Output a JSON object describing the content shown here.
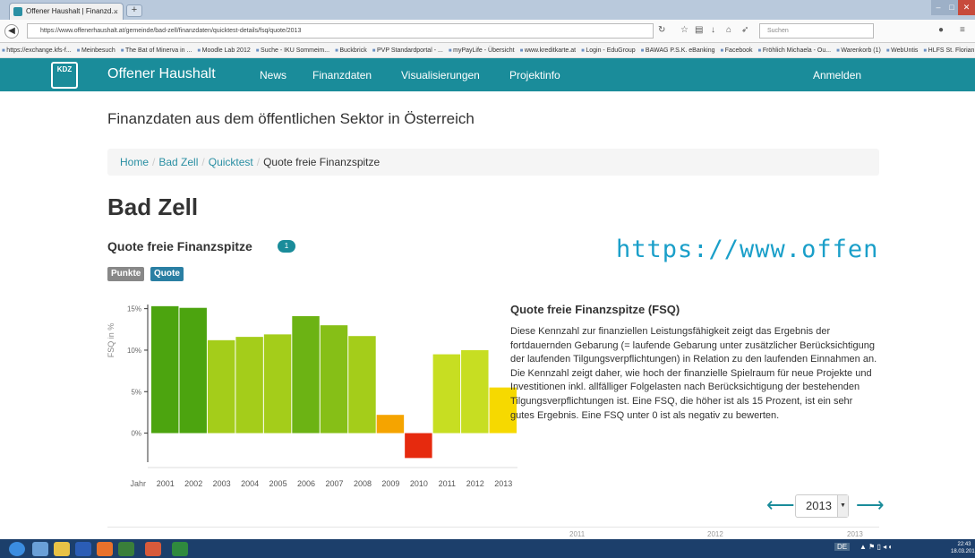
{
  "browser": {
    "tab_title": "Offener Haushalt | Finanzd...",
    "tab_close": "×",
    "new_tab": "+",
    "url": "https://www.offenerhaushalt.at/gemeinde/bad-zell/finanzdaten/quicktest-details/fsq/quote/2013",
    "search_placeholder": "Suchen",
    "bookmarks": [
      "https://exchange.kfs-f...",
      "Meinbesuch",
      "The Bat of Minerva in ...",
      "Moodle Lab 2012",
      "Suche - IKU Sommeim...",
      "Buckbrick",
      "PVP Standardportal - ...",
      "myPayLife - Übersicht",
      "www.kreditkarte.at",
      "Login - EduGroup",
      "BAWAG P.S.K. eBanking",
      "Facebook",
      "Fröhlich Michaela - Ou...",
      "Warenkorb (1)",
      "WebUntis",
      "HLFS St. Florian: Login ..."
    ]
  },
  "header": {
    "logo_text": "KDZ",
    "brand": "Offener Haushalt",
    "nav": [
      "News",
      "Finanzdaten",
      "Visualisierungen",
      "Projektinfo"
    ],
    "login": "Anmelden"
  },
  "page": {
    "subtitle": "Finanzdaten aus dem öffentlichen Sektor in Österreich",
    "breadcrumb": [
      "Home",
      "Bad Zell",
      "Quicktest",
      "Quote freie Finanzspitze"
    ],
    "breadcrumb_sep": "/",
    "heading": "Bad Zell",
    "section_title": "Quote freie Finanzspitze",
    "info_badge": "1",
    "toggle_points": "Punkte",
    "toggle_quote": "Quote",
    "overlay_url": "https://www.offen",
    "desc_title": "Quote freie Finanzspitze (FSQ)",
    "desc_body": "Diese Kennzahl zur finanziellen Leistungsfähigkeit zeigt das Ergebnis der fortdauernden Gebarung (= laufende Gebarung unter zusätzlicher Berücksichtigung der laufenden Tilgungsverpflichtungen) in Relation zu den laufenden Einnahmen an. Die Kennzahl zeigt daher, wie hoch der finanzielle Spielraum für neue Projekte und Investitionen inkl. allfälliger Folgelasten nach Berücksichtigung der bestehenden Tilgungsverpflichtungen ist. Eine FSQ, die höher ist als 15 Prozent, ist ein sehr gutes Ergebnis. Eine FSQ unter 0 ist als negativ zu bewerten.",
    "prev_arrow": "⟵",
    "next_arrow": "⟶",
    "selected_year": "2013",
    "peek_labels": [
      "2011",
      "2012",
      "2013"
    ]
  },
  "chart_data": {
    "type": "bar",
    "ylabel": "FSQ in %",
    "xlabel": "Jahr",
    "categories": [
      "2001",
      "2002",
      "2003",
      "2004",
      "2005",
      "2006",
      "2007",
      "2008",
      "2009",
      "2010",
      "2011",
      "2012",
      "2013"
    ],
    "values": [
      15.3,
      15.1,
      11.2,
      11.6,
      11.9,
      14.1,
      13.0,
      11.7,
      2.2,
      -3.0,
      9.5,
      10.0,
      5.5
    ],
    "colors": [
      "#4ca40f",
      "#4ca40f",
      "#a4cd1a",
      "#a4cd1a",
      "#a4cd1a",
      "#6cb314",
      "#86bf17",
      "#a4cd1a",
      "#f5a400",
      "#e62a0e",
      "#c7de22",
      "#c7de22",
      "#f6d900"
    ],
    "yticks": [
      0,
      5,
      10,
      15
    ],
    "ytick_labels": [
      "0%",
      "5%",
      "10%",
      "15%"
    ],
    "ylim": [
      -3.5,
      15.5
    ]
  },
  "taskbar": {
    "clock_time": "22:43",
    "clock_date": "18.03.2015",
    "lang": "DE"
  }
}
